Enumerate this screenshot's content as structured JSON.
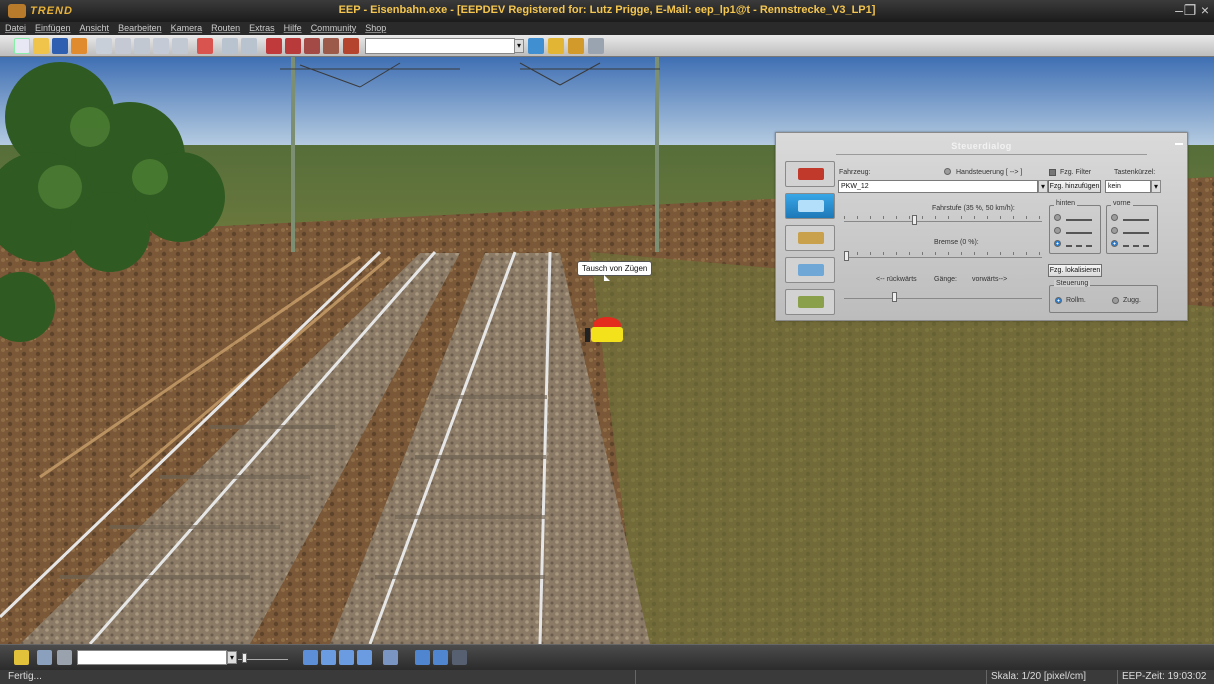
{
  "window": {
    "logo_text": "TREND",
    "title": "EEP - Eisenbahn.exe - [EEPDEV Registered for: Lutz Prigge, E-Mail: eep_lp1@t - Rennstrecke_V3_LP1]"
  },
  "menu": [
    "Datei",
    "Einfügen",
    "Ansicht",
    "Bearbeiten",
    "Kamera",
    "Routen",
    "Extras",
    "Hilfe",
    "Community",
    "Shop"
  ],
  "scene": {
    "tooltip": "Tausch von Zügen"
  },
  "steuerdialog": {
    "title": "Steuerdialog",
    "fahrzeug_label": "Fahrzeug:",
    "handsteuerung_label": "Handsteuerung [ --> ]",
    "fahrzeug_value": "PKW_12",
    "fzg_filter_label": "Fzg. Filter",
    "tastenkuerzel_label": "Tastenkürzel:",
    "fzg_hinzufuegen_label": "Fzg. hinzufügen",
    "tastenkuerzel_value": "kein",
    "fahrstufe_label": "Fahrstufe (35 %, 50 km/h):",
    "fahrstufe_percent": 35,
    "bremse_label": "Bremse (0 %):",
    "bremse_percent": 0,
    "gang_rueckwaerts": "<-- rückwärts",
    "gang_label": "Gänge:",
    "gang_vorwaerts": "vorwärts-->",
    "gang_position": 0.5,
    "hinten_label": "hinten",
    "vorne_label": "vorne",
    "fzg_lokalisieren_label": "Fzg. lokalisieren",
    "steuerung_label": "Steuerung",
    "rollm_label": "Rollm.",
    "zugg_label": "Zugg."
  },
  "status": {
    "left": "Fertig...",
    "scale": "Skala: 1/20 [pixel/cm]",
    "time": "EEP-Zeit: 19:03:02"
  },
  "colors": {
    "title_text": "#f4c64f",
    "accent_blue": "#2b80d6"
  }
}
